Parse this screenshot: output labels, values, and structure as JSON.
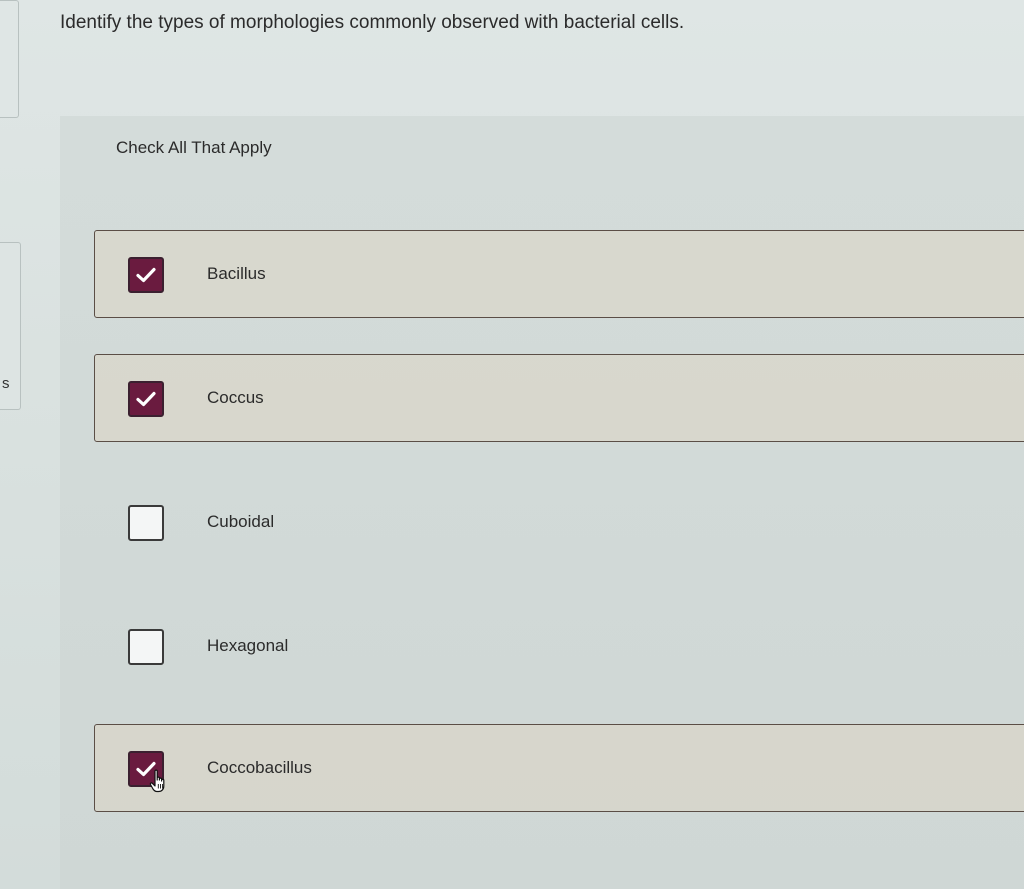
{
  "question": {
    "text": "Identify the types of morphologies commonly observed with bacterial cells."
  },
  "instruction": "Check All That Apply",
  "left_rail": {
    "letter": "s"
  },
  "options": [
    {
      "label": "Bacillus",
      "checked": true
    },
    {
      "label": "Coccus",
      "checked": true
    },
    {
      "label": "Cuboidal",
      "checked": false
    },
    {
      "label": "Hexagonal",
      "checked": false
    },
    {
      "label": "Coccobacillus",
      "checked": true
    }
  ],
  "colors": {
    "checked_fill": "#6a1b3f",
    "selected_border": "#5b4e46"
  },
  "icons": {
    "check": "check-icon",
    "cursor": "hand-pointer-icon"
  }
}
